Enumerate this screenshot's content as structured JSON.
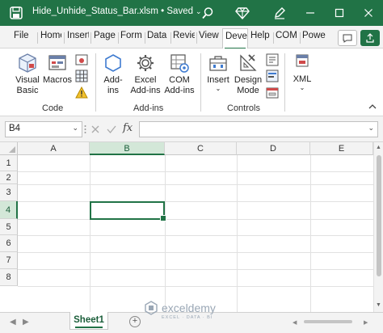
{
  "titlebar": {
    "title": "Hide_Unhide_Status_Bar.xlsm • Saved",
    "caret": "⌄",
    "icons": [
      "excel-save-icon",
      "search-icon",
      "diamond-icon",
      "pen-icon"
    ]
  },
  "tabs": [
    {
      "label": "File"
    },
    {
      "label": "Home"
    },
    {
      "label": "Insert"
    },
    {
      "label": "Page"
    },
    {
      "label": "Form"
    },
    {
      "label": "Data"
    },
    {
      "label": "Revie"
    },
    {
      "label": "View"
    },
    {
      "label": "Deve",
      "active": true
    },
    {
      "label": "Help"
    },
    {
      "label": "COM"
    },
    {
      "label": "Powe"
    }
  ],
  "ribbon": {
    "code": {
      "visual_basic": "Visual\nBasic",
      "macros": "Macros",
      "group_label": "Code"
    },
    "addins": {
      "addins": "Add-\nins",
      "excel_addins": "Excel\nAdd-ins",
      "com_addins": "COM\nAdd-ins",
      "group_label": "Add-ins"
    },
    "controls": {
      "insert": "Insert",
      "design_mode": "Design\nMode",
      "group_label": "Controls"
    },
    "xml": {
      "xml": "XML"
    }
  },
  "formula": {
    "name_box": "B4",
    "value": "",
    "fx": "fx"
  },
  "grid": {
    "columns": [
      "A",
      "B",
      "C",
      "D",
      "E"
    ],
    "rows": [
      "1",
      "2",
      "3",
      "4",
      "5",
      "6",
      "7",
      "8"
    ],
    "selected_col": "B",
    "selected_row": "4",
    "active_cell": "B4"
  },
  "sheets": {
    "tabs": [
      "Sheet1"
    ],
    "active": "Sheet1",
    "add": "+"
  },
  "watermark": {
    "name": "exceldemy",
    "tagline": "EXCEL · DATA · BI"
  },
  "colors": {
    "accent": "#217346",
    "selection_header": "#d3e7d8"
  }
}
